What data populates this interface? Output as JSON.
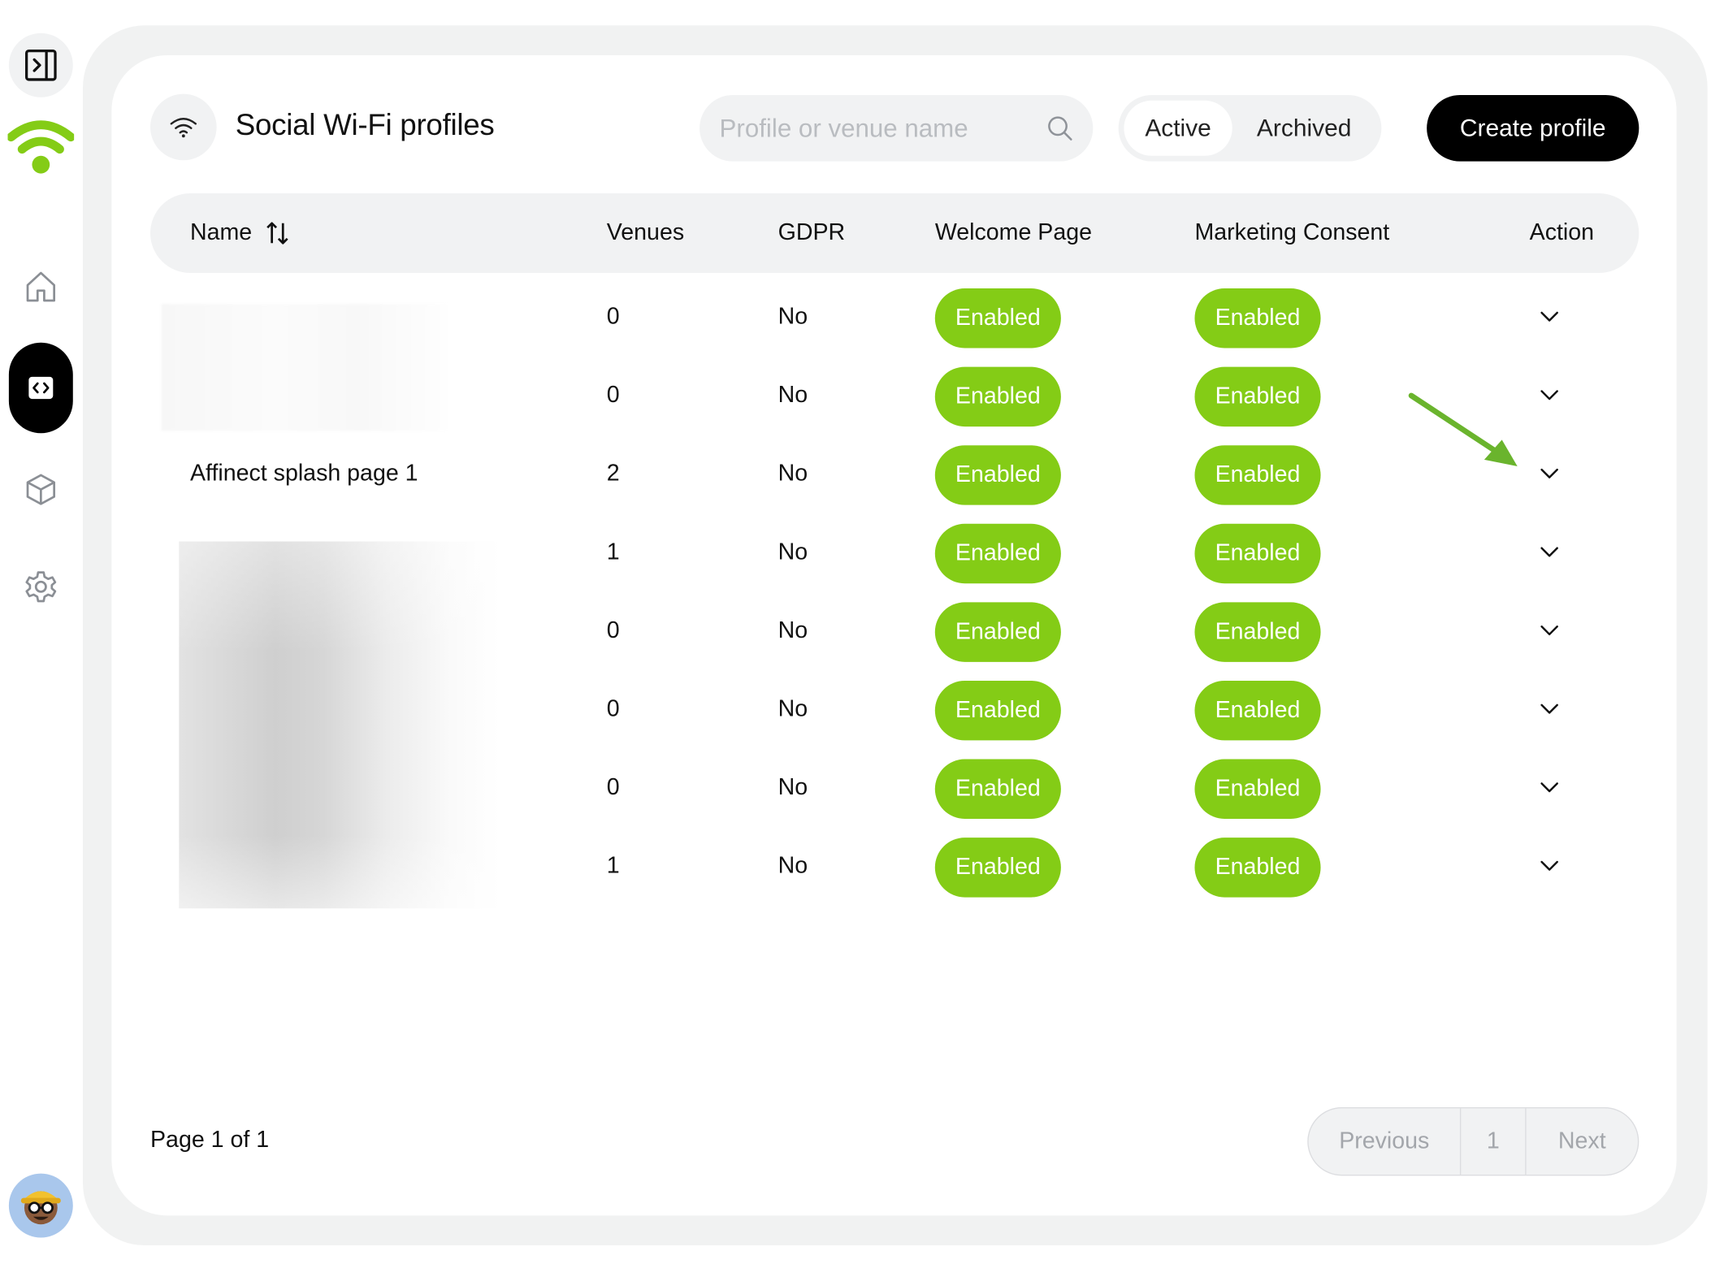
{
  "header": {
    "title": "Social Wi-Fi profiles",
    "search_placeholder": "Profile or venue name",
    "tabs": [
      {
        "label": "Active",
        "selected": true
      },
      {
        "label": "Archived",
        "selected": false
      }
    ],
    "create_label": "Create profile"
  },
  "table": {
    "columns": [
      "Name",
      "Venues",
      "GDPR",
      "Welcome Page",
      "Marketing Consent",
      "Action"
    ],
    "rows": [
      {
        "name": "",
        "venues": "0",
        "gdpr": "No",
        "welcome": "Enabled",
        "marketing": "Enabled"
      },
      {
        "name": "",
        "venues": "0",
        "gdpr": "No",
        "welcome": "Enabled",
        "marketing": "Enabled"
      },
      {
        "name": "Affinect splash page 1",
        "venues": "2",
        "gdpr": "No",
        "welcome": "Enabled",
        "marketing": "Enabled"
      },
      {
        "name": "",
        "venues": "1",
        "gdpr": "No",
        "welcome": "Enabled",
        "marketing": "Enabled"
      },
      {
        "name": "",
        "venues": "0",
        "gdpr": "No",
        "welcome": "Enabled",
        "marketing": "Enabled"
      },
      {
        "name": "",
        "venues": "0",
        "gdpr": "No",
        "welcome": "Enabled",
        "marketing": "Enabled"
      },
      {
        "name": "",
        "venues": "0",
        "gdpr": "No",
        "welcome": "Enabled",
        "marketing": "Enabled"
      },
      {
        "name": "",
        "venues": "1",
        "gdpr": "No",
        "welcome": "Enabled",
        "marketing": "Enabled"
      }
    ]
  },
  "footer": {
    "page_info": "Page 1 of 1",
    "previous": "Previous",
    "current_page": "1",
    "next": "Next"
  },
  "colors": {
    "accent": "#84cc16",
    "primary_button": "#000000",
    "surface": "#f1f2f3",
    "annotation_arrow": "#6ab42d"
  },
  "icons": {
    "sidebar": [
      "sidebar-toggle-icon",
      "wifi-logo-icon",
      "home-icon",
      "code-icon",
      "cube-icon",
      "gear-icon",
      "avatar"
    ],
    "header": [
      "wifi-icon",
      "search-icon"
    ],
    "table": [
      "sort-icon",
      "chevron-down-icon"
    ]
  }
}
